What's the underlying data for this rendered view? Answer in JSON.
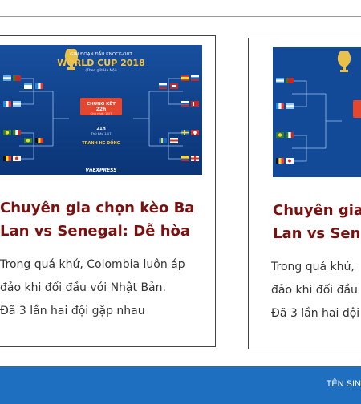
{
  "articles": [
    {
      "image": {
        "stage_label": "GIAI ĐOẠN ĐẤU KNOCK-OUT",
        "event_title": "WORLD CUP 2018",
        "time_note": "(Theo giờ Hà Nội)",
        "final_label": "CHUNG KẾT",
        "final_time": "22h",
        "final_date": "Chủ nhật 15/7",
        "third_place_label": "TRANH HC ĐỒNG",
        "third_time": "21h",
        "third_date": "Thứ Bảy 14/7",
        "brand": "VnEXPRESS"
      },
      "headline": [
        "Chuyên gia chọn kèo Ba",
        "Lan vs Senegal: Dễ hòa"
      ],
      "excerpt": [
        "Trong quá khứ, Colombia luôn áp",
        "đảo khi đối đầu với Nhật Bản.",
        "Đã 3 lần hai đội gặp nhau"
      ]
    },
    {
      "headline": [
        "Chuyên gia",
        "Lan vs Sene"
      ],
      "excerpt": [
        "Trong quá khứ,",
        "đảo khi đối đầu",
        "Đã 3 lần hai đội"
      ]
    }
  ],
  "footer": {
    "text": "TÊN SIN"
  },
  "colors": {
    "headline": "#7a1010",
    "footer_bg": "#1f6fc0",
    "thumb_bg": "#0d3b82"
  }
}
